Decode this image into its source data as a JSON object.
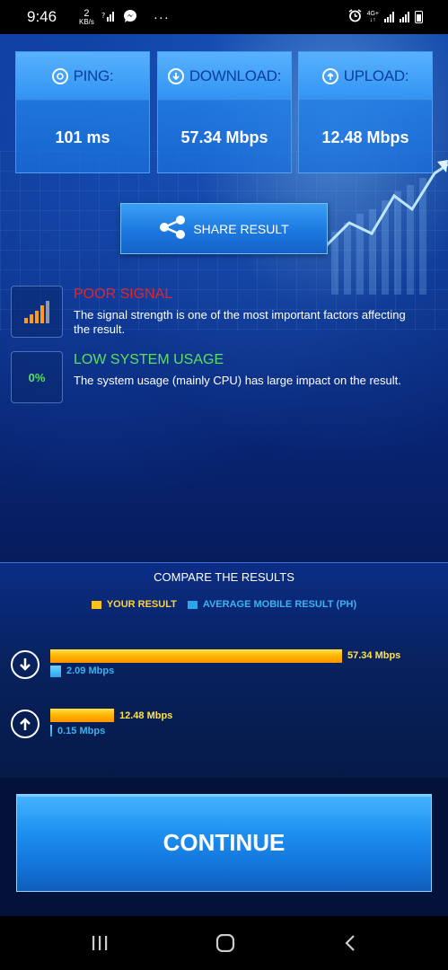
{
  "status_bar": {
    "time": "9:46",
    "data_rate_value": "2",
    "data_rate_unit": "KB/s",
    "more_glyph": "···",
    "network_type": "4G+",
    "icons": [
      "data-rate-icon",
      "wifi-call-icon",
      "messenger-icon",
      "more-icon",
      "alarm-icon",
      "network-4g-icon",
      "signal-icon",
      "signal-icon-2",
      "battery-icon"
    ]
  },
  "stats": [
    {
      "label": "PING:",
      "value": "101 ms",
      "icon": "ping-icon"
    },
    {
      "label": "DOWNLOAD:",
      "value": "57.34 Mbps",
      "icon": "download-icon"
    },
    {
      "label": "UPLOAD:",
      "value": "12.48 Mbps",
      "icon": "upload-icon"
    }
  ],
  "share": {
    "label": "SHARE RESULT",
    "icon": "share-icon"
  },
  "signal": {
    "title": "POOR SIGNAL",
    "description": "The signal strength is one of the most important factors affecting the result.",
    "title_color": "#e5232a",
    "icon": "signal-strength-icon"
  },
  "system_usage": {
    "badge": "0%",
    "title": "LOW SYSTEM USAGE",
    "description": "The system usage (mainly CPU) has large impact on the result.",
    "title_color": "#5ce05c"
  },
  "compare": {
    "title": "COMPARE THE RESULTS",
    "legend": {
      "yours": "YOUR RESULT",
      "average": "AVERAGE MOBILE RESULT (PH)"
    },
    "colors": {
      "yours": "#ffc21a",
      "average": "#2aa6ea"
    },
    "download": {
      "icon": "download-arrow-icon",
      "your_value_mbps": 57.34,
      "your_label": "57.34 Mbps",
      "avg_value_mbps": 2.09,
      "avg_label": "2.09 Mbps"
    },
    "upload": {
      "icon": "upload-arrow-icon",
      "your_value_mbps": 12.48,
      "your_label": "12.48 Mbps",
      "avg_value_mbps": 0.15,
      "avg_label": "0.15 Mbps"
    }
  },
  "continue": {
    "label": "CONTINUE"
  },
  "nav": {
    "icons": [
      "recent-apps-icon",
      "home-icon",
      "back-icon"
    ]
  }
}
